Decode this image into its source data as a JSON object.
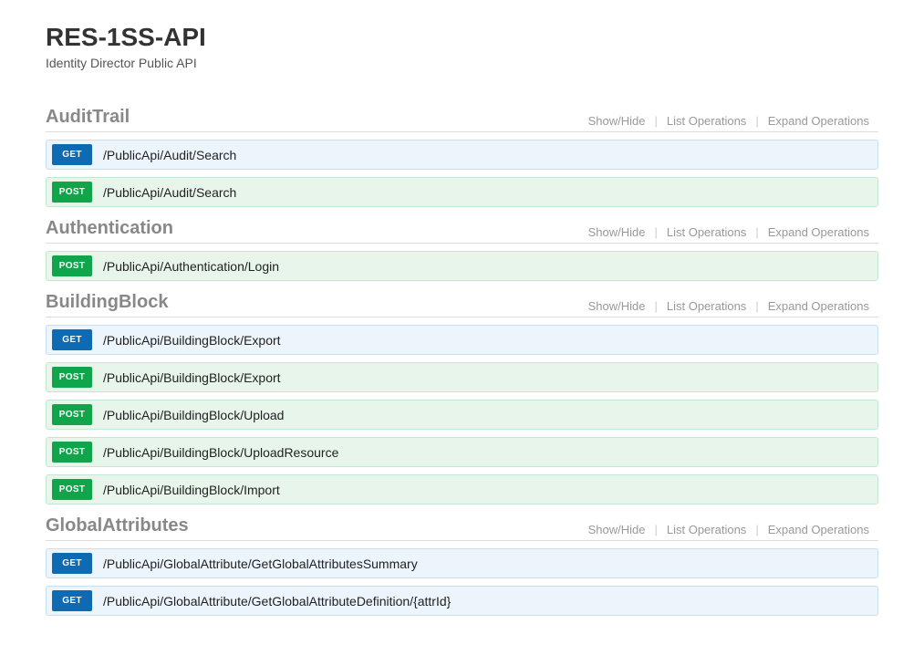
{
  "header": {
    "title": "RES-1SS-API",
    "subtitle": "Identity Director Public API"
  },
  "actions": {
    "show_hide": "Show/Hide",
    "list_ops": "List Operations",
    "expand_ops": "Expand Operations"
  },
  "badges": {
    "get": "GET",
    "post": "POST"
  },
  "sections": [
    {
      "title": "AuditTrail",
      "ops": [
        {
          "method": "get",
          "path": "/PublicApi/Audit/Search"
        },
        {
          "method": "post",
          "path": "/PublicApi/Audit/Search"
        }
      ]
    },
    {
      "title": "Authentication",
      "ops": [
        {
          "method": "post",
          "path": "/PublicApi/Authentication/Login"
        }
      ]
    },
    {
      "title": "BuildingBlock",
      "ops": [
        {
          "method": "get",
          "path": "/PublicApi/BuildingBlock/Export"
        },
        {
          "method": "post",
          "path": "/PublicApi/BuildingBlock/Export"
        },
        {
          "method": "post",
          "path": "/PublicApi/BuildingBlock/Upload"
        },
        {
          "method": "post",
          "path": "/PublicApi/BuildingBlock/UploadResource"
        },
        {
          "method": "post",
          "path": "/PublicApi/BuildingBlock/Import"
        }
      ]
    },
    {
      "title": "GlobalAttributes",
      "ops": [
        {
          "method": "get",
          "path": "/PublicApi/GlobalAttribute/GetGlobalAttributesSummary"
        },
        {
          "method": "get",
          "path": "/PublicApi/GlobalAttribute/GetGlobalAttributeDefinition/{attrId}"
        }
      ]
    }
  ]
}
